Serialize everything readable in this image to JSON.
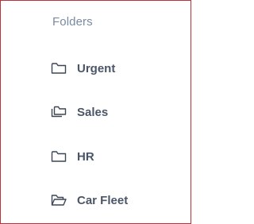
{
  "folders": {
    "title": "Folders",
    "items": [
      {
        "label": "Urgent",
        "icon": "folder-icon"
      },
      {
        "label": "Sales",
        "icon": "folders-stack-icon"
      },
      {
        "label": "HR",
        "icon": "folder-icon"
      },
      {
        "label": "Car Fleet",
        "icon": "folder-open-icon"
      }
    ]
  },
  "colors": {
    "border": "#c0303a",
    "title_text": "#7a8aa0",
    "item_text": "#4a5668",
    "icon_stroke": "#3c4654"
  }
}
